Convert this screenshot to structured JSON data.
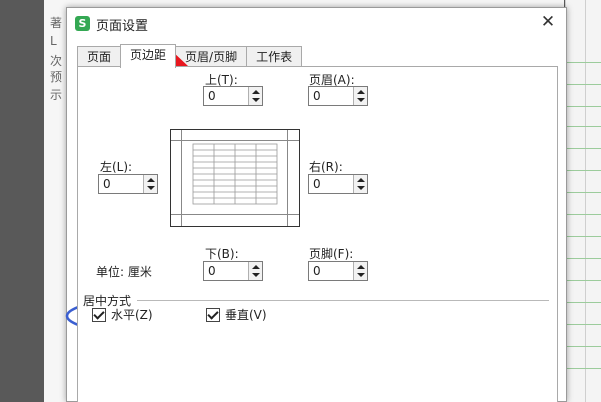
{
  "background": {
    "lines": [
      "著",
      "L",
      "次",
      "预",
      "示"
    ]
  },
  "dialog": {
    "app_icon_letter": "S",
    "title": "页面设置",
    "close_glyph": "✕",
    "tabs": [
      "页面",
      "页边距",
      "页眉/页脚",
      "工作表"
    ],
    "active_tab": 1,
    "fields": {
      "top": {
        "label": "上(T):",
        "value": "0"
      },
      "header": {
        "label": "页眉(A):",
        "value": "0"
      },
      "left": {
        "label": "左(L):",
        "value": "0"
      },
      "right": {
        "label": "右(R):",
        "value": "0"
      },
      "bottom": {
        "label": "下(B):",
        "value": "0"
      },
      "footer": {
        "label": "页脚(F):",
        "value": "0"
      }
    },
    "unit_label": "单位: 厘米",
    "center_section": {
      "title": "居中方式",
      "horizontal": {
        "label": "水平(Z)",
        "checked": true
      },
      "vertical": {
        "label": "垂直(V)",
        "checked": true
      }
    }
  },
  "annotation_colors": {
    "arrow": "#e8171f",
    "ellipse": "#3b5fd1"
  }
}
